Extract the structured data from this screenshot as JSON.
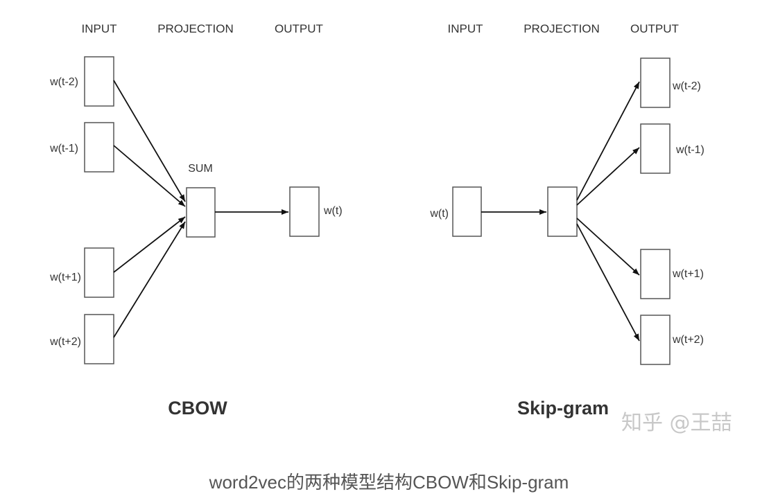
{
  "cbow": {
    "headers": {
      "input": "INPUT",
      "projection": "PROJECTION",
      "output": "OUTPUT"
    },
    "sum_label": "SUM",
    "inputs": [
      "w(t-2)",
      "w(t-1)",
      "w(t+1)",
      "w(t+2)"
    ],
    "output": "w(t)",
    "title": "CBOW"
  },
  "skipgram": {
    "headers": {
      "input": "INPUT",
      "projection": "PROJECTION",
      "output": "OUTPUT"
    },
    "input": "w(t)",
    "outputs": [
      "w(t-2)",
      "w(t-1)",
      "w(t+1)",
      "w(t+2)"
    ],
    "title": "Skip-gram"
  },
  "watermark": "知乎 @王喆",
  "caption": "word2vec的两种模型结构CBOW和Skip-gram"
}
